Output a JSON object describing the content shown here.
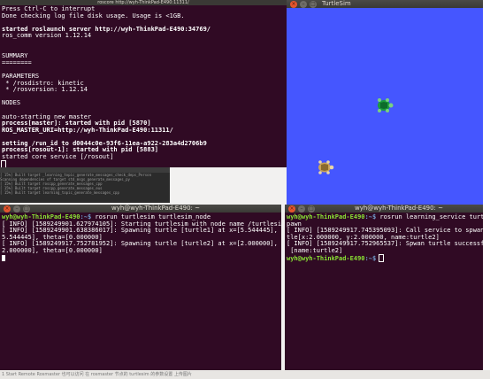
{
  "desktop": {
    "bottom_text": "1 Start Remote Rosmaster 也可以访问 在 rosmaster 节点的 turtlesim 的参数设置 上传图片"
  },
  "roscore_window": {
    "title": "roscore http://wyh-ThinkPad-E490:11311/",
    "lines": [
      "Press Ctrl-C to interrupt",
      "Done checking log file disk usage. Usage is <1GB.",
      "",
      "started roslaunch server http://wyh-ThinkPad-E490:34769/",
      "ros_comm version 1.12.14",
      "",
      "",
      "SUMMARY",
      "========",
      "",
      "PARAMETERS",
      " * /rosdistro: kinetic",
      " * /rosversion: 1.12.14",
      "",
      "NODES",
      "",
      "auto-starting new master",
      "process[master]: started with pid [5870]",
      "ROS_MASTER_URI=http://wyh-ThinkPad-E490:11311/",
      "",
      "setting /run_id to d0044c0e-93f6-11ea-a922-283a4d2706b9",
      "process[rosout-1]: started with pid [5883]",
      "started core service [/rosout]"
    ]
  },
  "turtlesim_window": {
    "title": "TurtleSim",
    "turtles": [
      {
        "name": "turtle1",
        "color": "#1a9b3c"
      },
      {
        "name": "turtle2",
        "color": "#c8a25a"
      }
    ],
    "background_color": "#4556ff"
  },
  "bg_window": {
    "lines": [
      "[ 15%] Built target _learning_topic_generate_messages_check_deps_Person",
      "Scanning dependencies of target std_msgs_generate_messages_py",
      "[ 15%] Built target roscpp_generate_messages_cpp",
      "[ 15%] Built target roscpp_generate_messages_eus",
      "[ 15%] Built target learning_topic_generate_messages_cpp"
    ]
  },
  "terminal_left": {
    "title": "wyh@wyh-ThinkPad-E490: ~",
    "prompt_user": "wyh@wyh-ThinkPad-E490",
    "prompt_path": ":~$",
    "command": " rosrun turtlesim turtlesim_node",
    "lines": [
      "[ INFO] [1589249901.627974105]: Starting turtlesim with node name /turtlesim",
      "[ INFO] [1589249901.638386017]: Spawning turtle [turtle1] at x=[5.544445], y=[",
      "5.544445], theta=[0.000000]",
      "[ INFO] [1589249917.752781952]: Spawning turtle [turtle2] at x=[2.000000], y=[",
      "2.000000], theta=[0.000000]"
    ]
  },
  "terminal_right": {
    "title": "wyh@wyh-ThinkPad-E490: ~",
    "prompt_user": "wyh@wyh-ThinkPad-E490",
    "prompt_path": ":~$",
    "command": " rosrun learning_service turtle_s",
    "lines": [
      "pawn",
      "[ INFO] [1589249917.745395093]: Call service to spwan tur",
      "tle[x:2.000000, y:2.000000, name:turtle2]",
      "[ INFO] [1589249917.752965537]: Spwan turtle successfully",
      " [name:turtle2]"
    ],
    "final_prompt_user": "wyh@wyh-ThinkPad-E490",
    "final_prompt_path": ":~$"
  }
}
